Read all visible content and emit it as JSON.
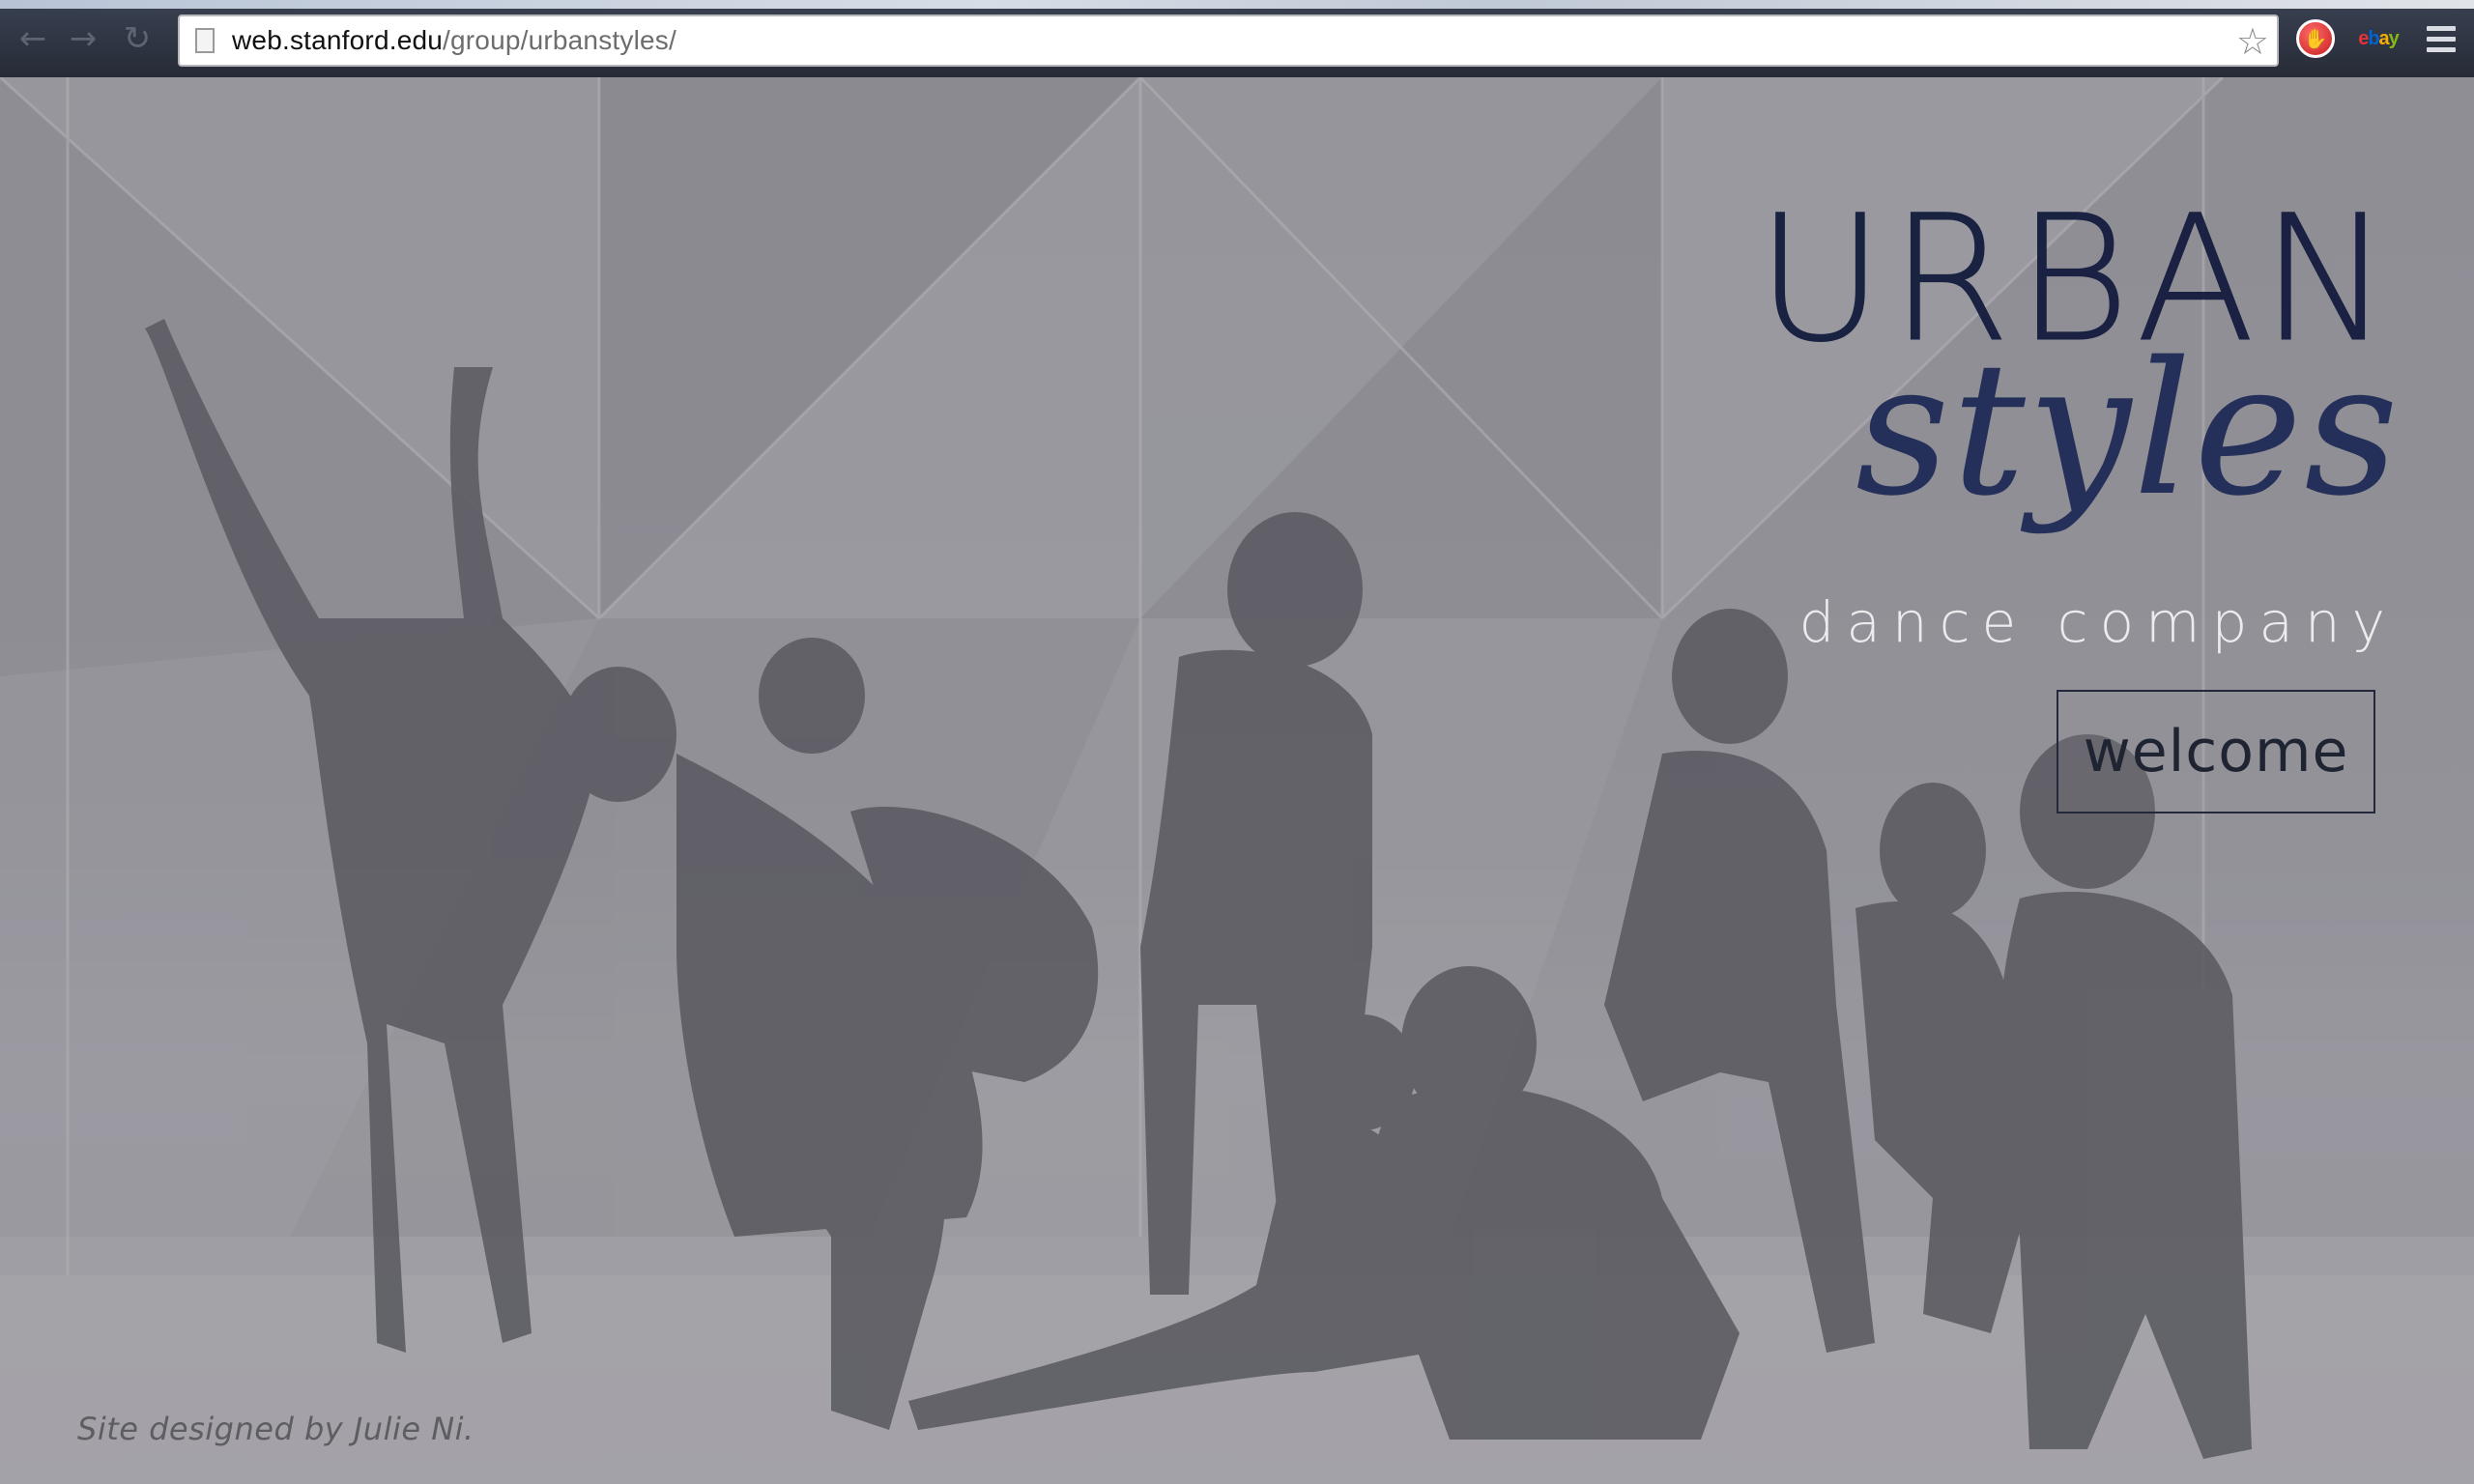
{
  "browser": {
    "url_host": "web.stanford.edu",
    "url_path": "/group/urbanstyles/",
    "back_icon": "back-arrow-icon",
    "forward_icon": "forward-arrow-icon",
    "reload_icon": "reload-icon",
    "bookmark_icon": "star-icon",
    "extensions": [
      "stop-sign-icon",
      "ebay-icon"
    ],
    "ebay_letters": [
      "e",
      "b",
      "a",
      "y"
    ],
    "menu_icon": "hamburger-menu-icon"
  },
  "hero": {
    "logo_line1": "URBAN",
    "logo_line2": "styles",
    "tagline": "dance company",
    "welcome_label": "welcome",
    "credit": "Site designed by Julie Ni.",
    "colors": {
      "logo_urban": "#141c3e",
      "logo_styles": "#25305a",
      "tagline": "#ececef",
      "overlay": "#8f8f93"
    }
  }
}
